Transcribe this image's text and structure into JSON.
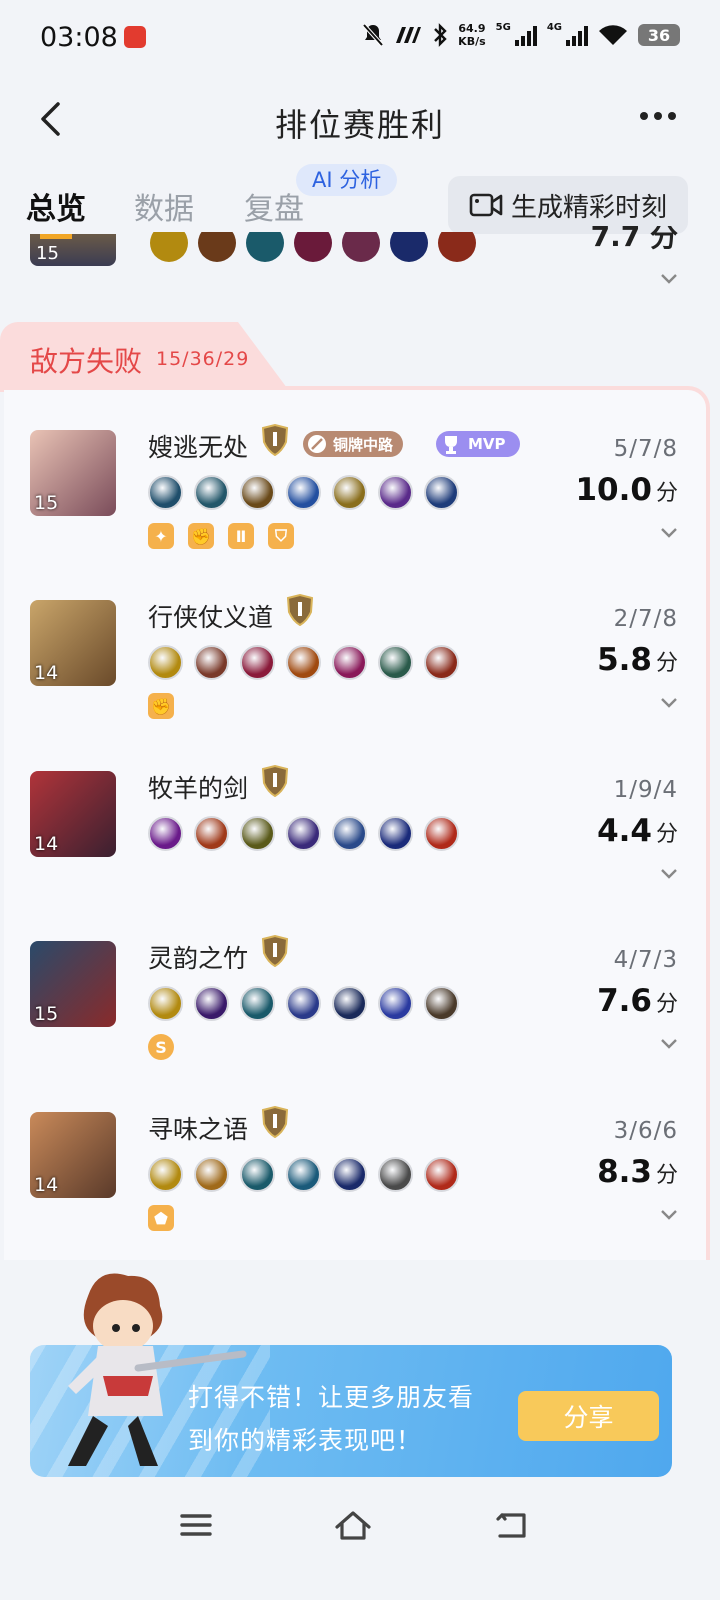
{
  "status_bar": {
    "time": "03:08",
    "net_speed_value": "64.9",
    "net_speed_unit": "KB/s",
    "signal1": "5G",
    "signal2": "4G",
    "battery": "36"
  },
  "header": {
    "title": "排位赛胜利"
  },
  "tabs": [
    {
      "label": "总览",
      "active": true
    },
    {
      "label": "数据",
      "active": false
    },
    {
      "label": "复盘",
      "active": false
    }
  ],
  "ai_badge": "AI 分析",
  "generate_button": "生成精彩时刻",
  "partial_row": {
    "level": "15",
    "score": "7.7 分"
  },
  "enemy_team": {
    "label": "敌方失败",
    "kda": "15/36/29"
  },
  "players": [
    {
      "name": "嫂逃无处",
      "level": "15",
      "kda": "5/7/8",
      "score": "10.0",
      "unit": "分",
      "badge_text": "铜牌中路",
      "mvp_text": "MVP",
      "avatar_colors": [
        "#e9c3b5",
        "#7a4c5a"
      ],
      "items": [
        "#1f4e6b",
        "#23576a",
        "#6a4a1a",
        "#2450a0",
        "#8a6e1c",
        "#5a2a8a",
        "#1e3c7a"
      ],
      "tags": [
        "✦",
        "✊",
        "Ⅱ",
        "⛉"
      ]
    },
    {
      "name": "行侠仗义道",
      "level": "14",
      "kda": "2/7/8",
      "score": "5.8",
      "unit": "分",
      "avatar_colors": [
        "#c9a56a",
        "#6a4a2a"
      ],
      "items": [
        "#b28a10",
        "#7a3a2a",
        "#8a1a3a",
        "#a04a10",
        "#8a1a5a",
        "#2a5a4a",
        "#8a2a1a"
      ],
      "tags": [
        "✊"
      ]
    },
    {
      "name": "牧羊的剑",
      "level": "14",
      "kda": "1/9/4",
      "score": "4.4",
      "unit": "分",
      "avatar_colors": [
        "#b0343a",
        "#3a2030"
      ],
      "items": [
        "#6a1a8a",
        "#a03a1a",
        "#5a5a1a",
        "#3a2a7a",
        "#2a4a8a",
        "#1a2a7a",
        "#b02a1a"
      ],
      "tags": []
    },
    {
      "name": "灵韵之竹",
      "level": "15",
      "kda": "4/7/3",
      "score": "7.6",
      "unit": "分",
      "avatar_colors": [
        "#2a4a6a",
        "#8a2a2a"
      ],
      "items": [
        "#b28a10",
        "#3a1a6a",
        "#1a5a6a",
        "#2a3a8a",
        "#1a2a5a",
        "#2a3aa0",
        "#4a3a2a"
      ],
      "tags": [
        "S"
      ]
    },
    {
      "name": "寻味之语",
      "level": "14",
      "kda": "3/6/6",
      "score": "8.3",
      "unit": "分",
      "avatar_colors": [
        "#c98a5a",
        "#5a3a2a"
      ],
      "items": [
        "#b28a10",
        "#a06a1a",
        "#1a5a6a",
        "#1a5a7a",
        "#1a2a6a",
        "#4a4a4a",
        "#b02a1a"
      ],
      "tags": [
        "⬟"
      ]
    }
  ],
  "share_banner": {
    "line1": "打得不错！让更多朋友看",
    "line2": "到你的精彩表现吧！",
    "button": "分享"
  }
}
